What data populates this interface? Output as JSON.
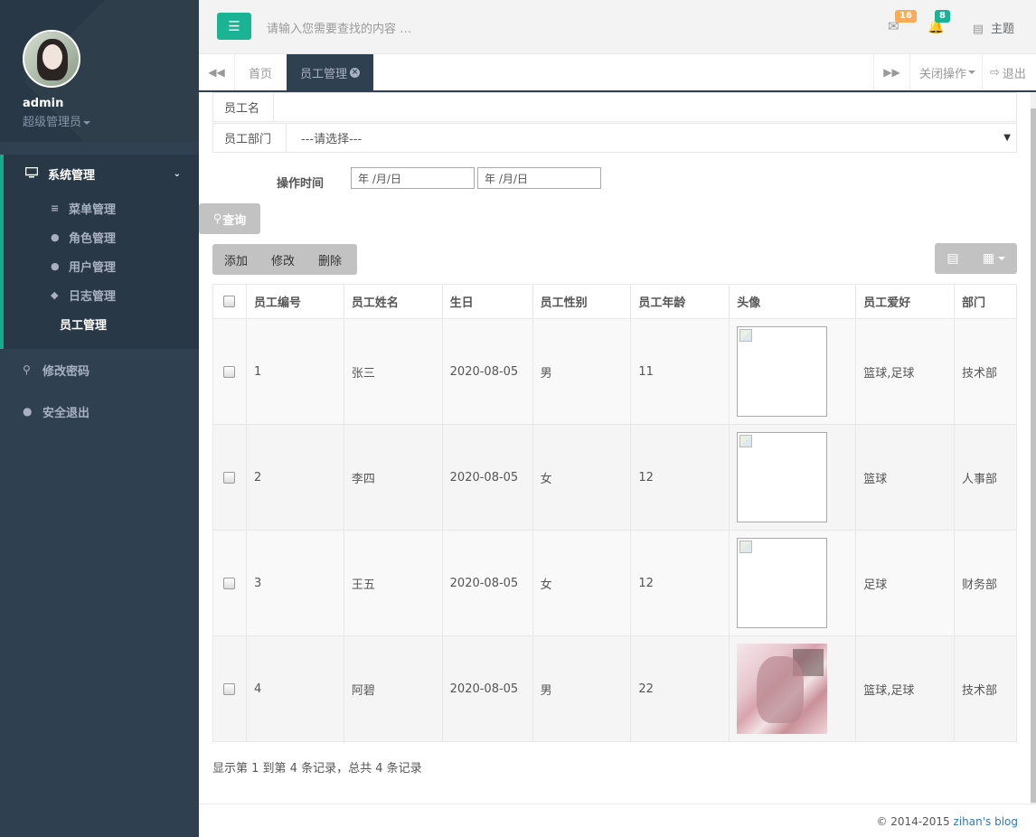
{
  "user": {
    "name": "admin",
    "role": "超级管理员"
  },
  "sidebar": {
    "group_label": "系统管理",
    "sub_items": [
      {
        "label": "菜单管理",
        "icon": "sliders-icon"
      },
      {
        "label": "角色管理",
        "icon": "users-icon"
      },
      {
        "label": "用户管理",
        "icon": "user-icon"
      },
      {
        "label": "日志管理",
        "icon": "tags-icon"
      },
      {
        "label": "员工管理",
        "icon": ""
      }
    ],
    "change_password": "修改密码",
    "logout": "安全退出"
  },
  "topbar": {
    "search_placeholder": "请输入您需要查找的内容 …",
    "mail_count": "16",
    "notify_count": "8",
    "theme_label": "主题"
  },
  "tabs": {
    "home": "首页",
    "active": "员工管理",
    "close_ops": "关闭操作",
    "exit": "退出"
  },
  "form": {
    "name_label": "员工名",
    "dept_label": "员工部门",
    "dept_value": "---请选择---",
    "time_label": "操作时间",
    "date_placeholder_1": "年 /月/日",
    "date_placeholder_2": "年 /月/日",
    "query_label": "查询"
  },
  "toolbar": {
    "add": "添加",
    "edit": "修改",
    "delete": "删除"
  },
  "table": {
    "headers": [
      "员工编号",
      "员工姓名",
      "生日",
      "员工性别",
      "员工年龄",
      "头像",
      "员工爱好",
      "部门"
    ],
    "rows": [
      {
        "id": "1",
        "name": "张三",
        "birthday": "2020-08-05",
        "gender": "男",
        "age": "11",
        "hobby": "篮球,足球",
        "dept": "技术部"
      },
      {
        "id": "2",
        "name": "李四",
        "birthday": "2020-08-05",
        "gender": "女",
        "age": "12",
        "hobby": "篮球",
        "dept": "人事部"
      },
      {
        "id": "3",
        "name": "王五",
        "birthday": "2020-08-05",
        "gender": "女",
        "age": "12",
        "hobby": "足球",
        "dept": "财务部"
      },
      {
        "id": "4",
        "name": "阿碧",
        "birthday": "2020-08-05",
        "gender": "男",
        "age": "22",
        "hobby": "篮球,足球",
        "dept": "技术部"
      }
    ]
  },
  "summary": "显示第 1 到第 4 条记录，总共 4 条记录",
  "footer": {
    "copyright": "© 2014-2015 ",
    "link": "zihan's blog"
  },
  "colors": {
    "accent": "#1ab394",
    "sidebar": "#2f4050",
    "mail_badge": "#f8ac59",
    "notify_badge": "#1ab394"
  }
}
